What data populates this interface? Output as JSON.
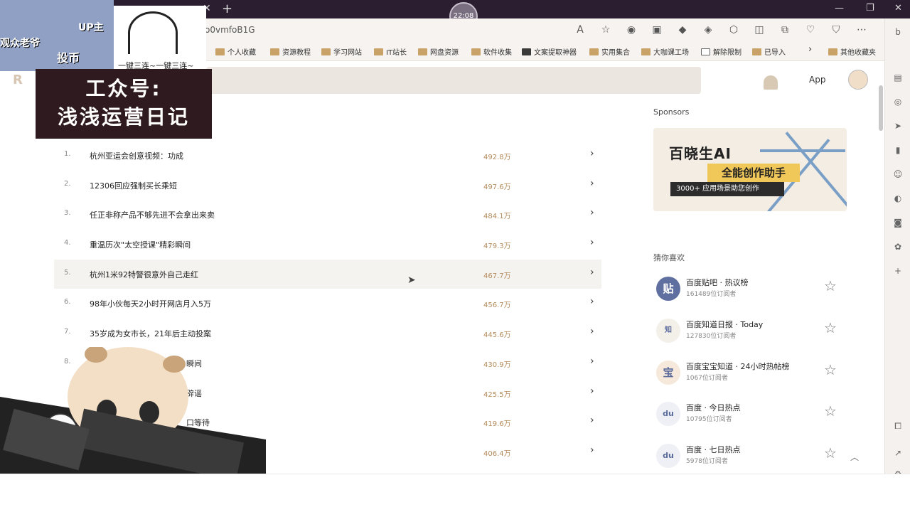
{
  "browser": {
    "url_fragment": "o0vmfoB1G",
    "clock": "22:08",
    "toolbar_icons": [
      "read-aloud-icon",
      "favorite-icon",
      "extension-1-icon",
      "extension-2-icon",
      "extension-3-icon",
      "extension-4-icon",
      "extension-5-icon",
      "split-screen-icon",
      "collections-icon",
      "health-icon",
      "browser-essentials-icon",
      "more-icon",
      "bing-icon"
    ]
  },
  "bookmarks": [
    {
      "label": "个人收藏"
    },
    {
      "label": "资源教程"
    },
    {
      "label": "学习网站"
    },
    {
      "label": "IT站长"
    },
    {
      "label": "网盘资源"
    },
    {
      "label": "软件收集"
    },
    {
      "label": "文案提取神器"
    },
    {
      "label": "实用集合"
    },
    {
      "label": "大咖课工场"
    },
    {
      "label": "解除限制"
    },
    {
      "label": "已导入"
    },
    {
      "label": "›"
    },
    {
      "label": "其他收藏夹"
    }
  ],
  "header": {
    "app_label": "App"
  },
  "overlay": {
    "viewer_label": "观众老爷",
    "up_label": "UP主",
    "coin_label": "投币",
    "face_caption": "一键三连~一键三连~",
    "promo_line1": "工众号:",
    "promo_line2": "浅浅运营日记"
  },
  "hot_list": [
    {
      "rank": "1.",
      "title": "杭州亚运会创意视频：功成",
      "heat": "492.8万"
    },
    {
      "rank": "2.",
      "title": "12306回应强制买长乘短",
      "heat": "497.6万"
    },
    {
      "rank": "3.",
      "title": "任正非称产品不够先进不会拿出来卖",
      "heat": "484.1万"
    },
    {
      "rank": "4.",
      "title": "重温历次\"太空授课\"精彩瞬间",
      "heat": "479.3万"
    },
    {
      "rank": "5.",
      "title": "杭州1米92特警很意外自己走红",
      "heat": "467.7万"
    },
    {
      "rank": "6.",
      "title": "98年小伙每天2小时开网店月入5万",
      "heat": "456.7万"
    },
    {
      "rank": "7.",
      "title": "35岁成为女市长，21年后主动投案",
      "heat": "445.6万"
    },
    {
      "rank": "8.",
      "title": "瞬间",
      "heat": "430.9万"
    },
    {
      "rank": "",
      "title": "辟谣",
      "heat": "425.5万"
    },
    {
      "rank": "",
      "title": "口等待",
      "heat": "419.6万"
    },
    {
      "rank": "",
      "title": "",
      "heat": "406.4万"
    }
  ],
  "sidebar": {
    "sponsors_label": "Sponsors",
    "ad": {
      "title": "百晓生AI",
      "tagline": "全能创作助手",
      "sub": "3000+ 应用场景助您创作"
    },
    "guess_label": "猜你喜欢",
    "subscriptions": [
      {
        "avatar": "贴",
        "name": "百度贴吧 · 热议榜",
        "count": "161489位订阅者"
      },
      {
        "avatar": "知",
        "name": "百度知道日报 · Today",
        "count": "127830位订阅者"
      },
      {
        "avatar": "宝",
        "name": "百度宝宝知道 · 24小时热帖榜",
        "count": "1067位订阅者"
      },
      {
        "avatar": "du",
        "name": "百度 · 今日热点",
        "count": "10795位订阅者"
      },
      {
        "avatar": "du",
        "name": "百度 · 七日热点",
        "count": "5978位订阅者"
      }
    ]
  }
}
